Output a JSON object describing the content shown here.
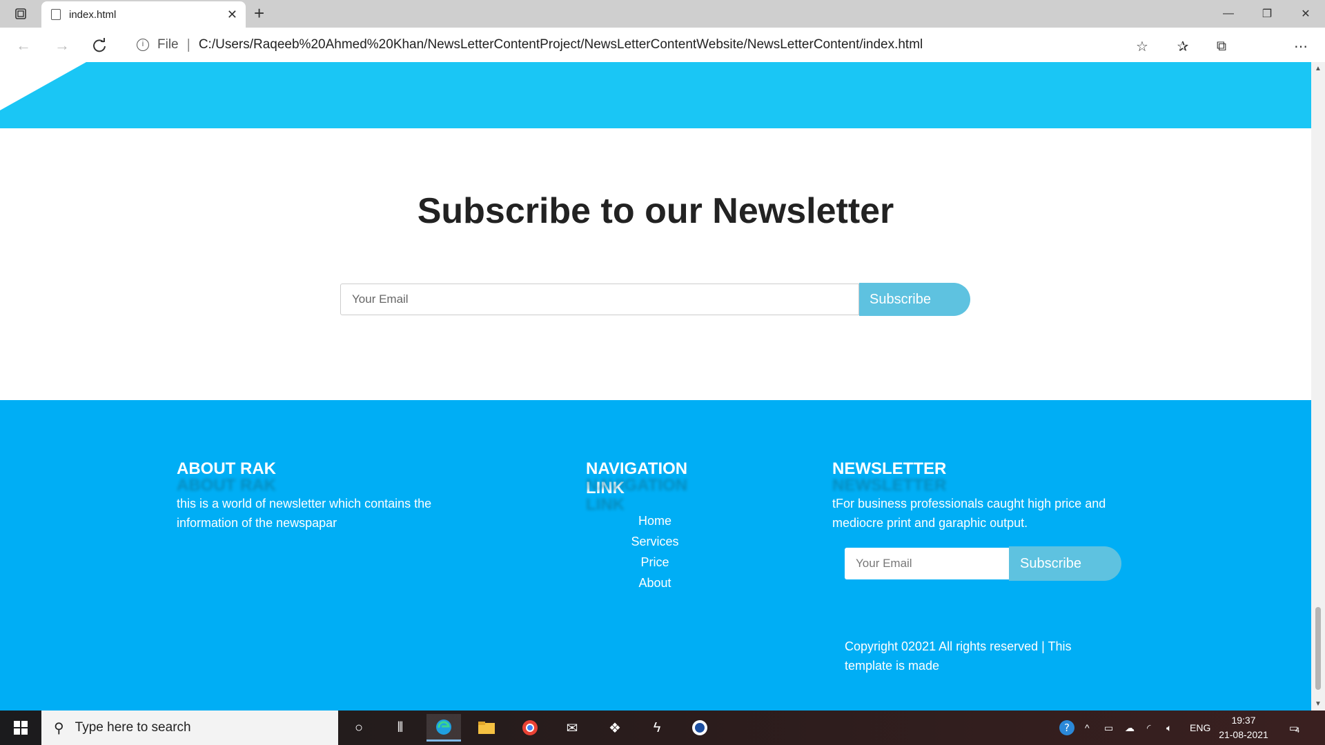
{
  "browser": {
    "tab_title": "index.html",
    "address_scheme": "File",
    "address_url": "C:/Users/Raqeeb%20Ahmed%20Khan/NewsLetterContentProject/NewsLetterContentWebsite/NewsLetterContent/index.html"
  },
  "subscribe_section": {
    "title": "Subscribe to our Newsletter",
    "email_placeholder": "Your Email",
    "button_label": "Subscribe"
  },
  "footer": {
    "about": {
      "heading": "ABOUT RAK",
      "text": "this is a world of newsletter which contains the information of the newspapar"
    },
    "navigation": {
      "heading": "NAVIGATION LINK",
      "links": [
        "Home",
        "Services",
        "Price",
        "About"
      ]
    },
    "newsletter": {
      "heading": "NEWSLETTER",
      "text": "tFor business professionals caught high price and mediocre print and garaphic output.",
      "email_placeholder": "Your Email",
      "button_label": "Subscribe"
    },
    "copyright": "Copyright 02021 All rights reserved | This template is made"
  },
  "taskbar": {
    "search_placeholder": "Type here to search",
    "language": "ENG",
    "time": "19:37",
    "date": "21-08-2021",
    "notification_count": "4"
  },
  "colors": {
    "hero": "#1ac6f5",
    "footer": "#00aef5",
    "button": "#5ec2e0"
  }
}
